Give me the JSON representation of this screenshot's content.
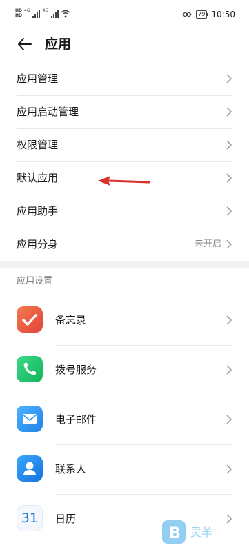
{
  "status_bar": {
    "time": "10:50",
    "battery": "79",
    "network_left": "4G"
  },
  "header": {
    "title": "应用"
  },
  "menu": [
    {
      "label": "应用管理",
      "value": ""
    },
    {
      "label": "应用启动管理",
      "value": ""
    },
    {
      "label": "权限管理",
      "value": ""
    },
    {
      "label": "默认应用",
      "value": ""
    },
    {
      "label": "应用助手",
      "value": ""
    },
    {
      "label": "应用分身",
      "value": "未开启"
    }
  ],
  "settings_section": {
    "title": "应用设置"
  },
  "apps": [
    {
      "label": "备忘录",
      "icon": "notes-icon",
      "color": "#e8563e"
    },
    {
      "label": "拨号服务",
      "icon": "phone-icon",
      "color": "#20c46a"
    },
    {
      "label": "电子邮件",
      "icon": "mail-icon",
      "color": "#2b95ef"
    },
    {
      "label": "联系人",
      "icon": "contacts-icon",
      "color": "#2288e8"
    },
    {
      "label": "日历",
      "icon": "calendar-icon",
      "icon_text": "31",
      "color": "#1e7fd6"
    }
  ],
  "annotation": {
    "arrow_color": "#d9312a",
    "target": "默认应用"
  },
  "watermark": {
    "text": "灵羊"
  }
}
